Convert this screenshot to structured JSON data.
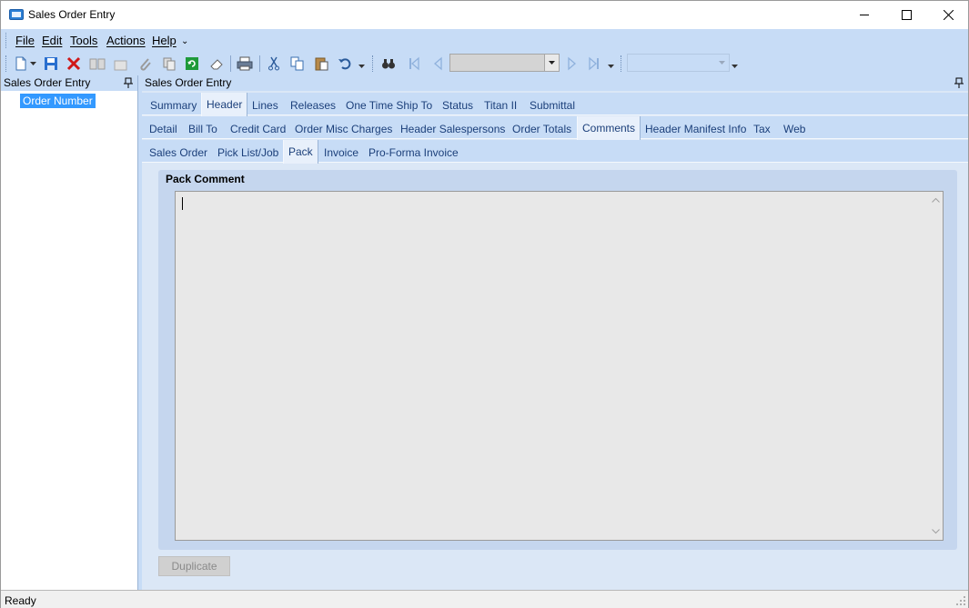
{
  "window": {
    "title": "Sales Order Entry"
  },
  "menu": {
    "items": [
      "File",
      "Edit",
      "Tools",
      "Actions",
      "Help"
    ],
    "overflow": "⌄"
  },
  "toolbar": {
    "record_combo_value": "",
    "second_combo_value": "",
    "overflow": "⌄"
  },
  "left_pane": {
    "header": "Sales Order Entry",
    "tree_items": [
      "Order Number"
    ]
  },
  "right_pane": {
    "header": "Sales Order Entry",
    "tabs_level1": [
      "Summary",
      "Header",
      "Lines",
      "Releases",
      "One Time Ship To",
      "Status",
      "Titan II",
      "Submittal"
    ],
    "tabs_level1_active": "Header",
    "tabs_level2": [
      "Detail",
      "Bill To",
      "Credit Card",
      "Order Misc Charges",
      "Header Salespersons",
      "Order Totals",
      "Comments",
      "Header Manifest Info",
      "Tax",
      "Web"
    ],
    "tabs_level2_active": "Comments",
    "tabs_level3": [
      "Sales Order",
      "Pick List/Job",
      "Pack",
      "Invoice",
      "Pro-Forma Invoice"
    ],
    "tabs_level3_active": "Pack",
    "group_title": "Pack Comment",
    "comment_value": "",
    "duplicate_label": "Duplicate"
  },
  "status": {
    "text": "Ready"
  },
  "colors": {
    "accent": "#3399ff",
    "band": "#c7dcf6",
    "tab_text": "#1b3f7a"
  }
}
